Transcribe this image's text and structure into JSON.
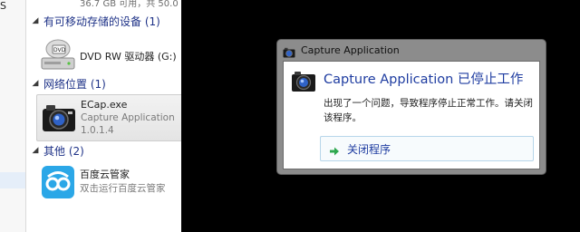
{
  "explorer": {
    "top_partial_text": "36.7 GB 可用，共 50.0",
    "nav_partial_text": "S",
    "groups": [
      {
        "title": "有可移动存储的设备 (1)",
        "items": [
          {
            "title": "DVD RW 驱动器 (G:)",
            "icon": "dvd-drive-icon"
          }
        ]
      },
      {
        "title": "网络位置 (1)",
        "items": [
          {
            "title": "ECap.exe",
            "subtitle1": "Capture Application",
            "subtitle2": "1.0.1.4",
            "icon": "camera-app-icon"
          }
        ]
      },
      {
        "title": "其他 (2)",
        "items": [
          {
            "title": "百度云管家",
            "subtitle1": "双击运行百度云管家",
            "icon": "baidu-cloud-icon"
          }
        ]
      }
    ]
  },
  "dialog": {
    "window_title": "Capture Application",
    "heading": "Capture Application 已停止工作",
    "message": "出现了一个问题，导致程序停止正常工作。请关闭该程序。",
    "action_label": "关闭程序",
    "icons": {
      "app": "camera-app-icon",
      "action": "green-arrow-icon"
    }
  },
  "colors": {
    "link_blue": "#1f3da1",
    "group_header_blue": "#1e3287",
    "background": "#000000",
    "dialog_frame": "#8c8c8c"
  }
}
